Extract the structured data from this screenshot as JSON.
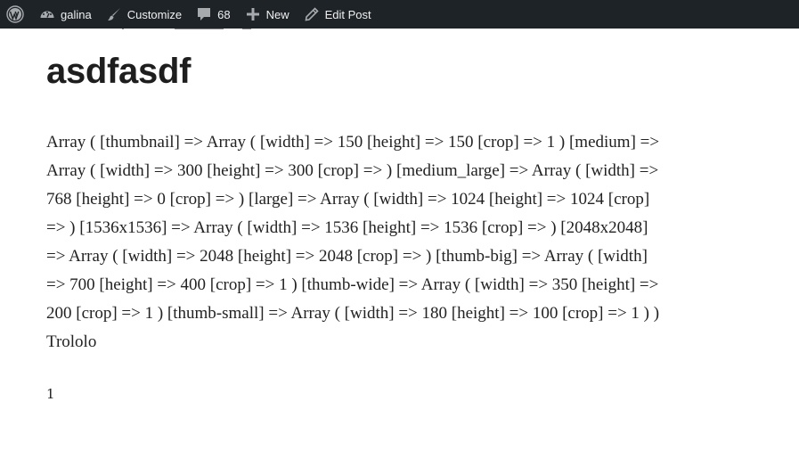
{
  "admin_bar": {
    "wp_logo_icon": "wordpress-logo-icon",
    "site_name": "galina",
    "site_icon": "dashboard-icon",
    "customize_label": "Customize",
    "customize_icon": "paintbrush-icon",
    "comments_count": "68",
    "comments_icon": "comment-bubble-icon",
    "new_label": "New",
    "new_icon": "plus-icon",
    "edit_label": "Edit Post",
    "edit_icon": "pencil-icon",
    "background_color": "#1d2327",
    "text_color": "#f0f0f1"
  },
  "post": {
    "title": "asdfasdf",
    "array_dump": "Array ( [thumbnail] => Array ( [width] => 150 [height] => 150 [crop] => 1 ) [medium] => Array ( [width] => 300 [height] => 300 [crop] => ) [medium_large] => Array ( [width] => 768 [height] => 0 [crop] => ) [large] => Array ( [width] => 1024 [height] => 1024 [crop] => ) [1536x1536] => Array ( [width] => 1536 [height] => 1536 [crop] => ) [2048x2048] => Array ( [width] => 2048 [height] => 2048 [crop] => ) [thumb-big] => Array ( [width] => 700 [height] => 400 [crop] => 1 ) [thumb-wide] => Array ( [width] => 350 [height] => 200 [crop] => 1 ) [thumb-small] => Array ( [width] => 180 [height] => 100 [crop] => 1 ) )",
    "body_text": "Trololo",
    "number": "1"
  }
}
